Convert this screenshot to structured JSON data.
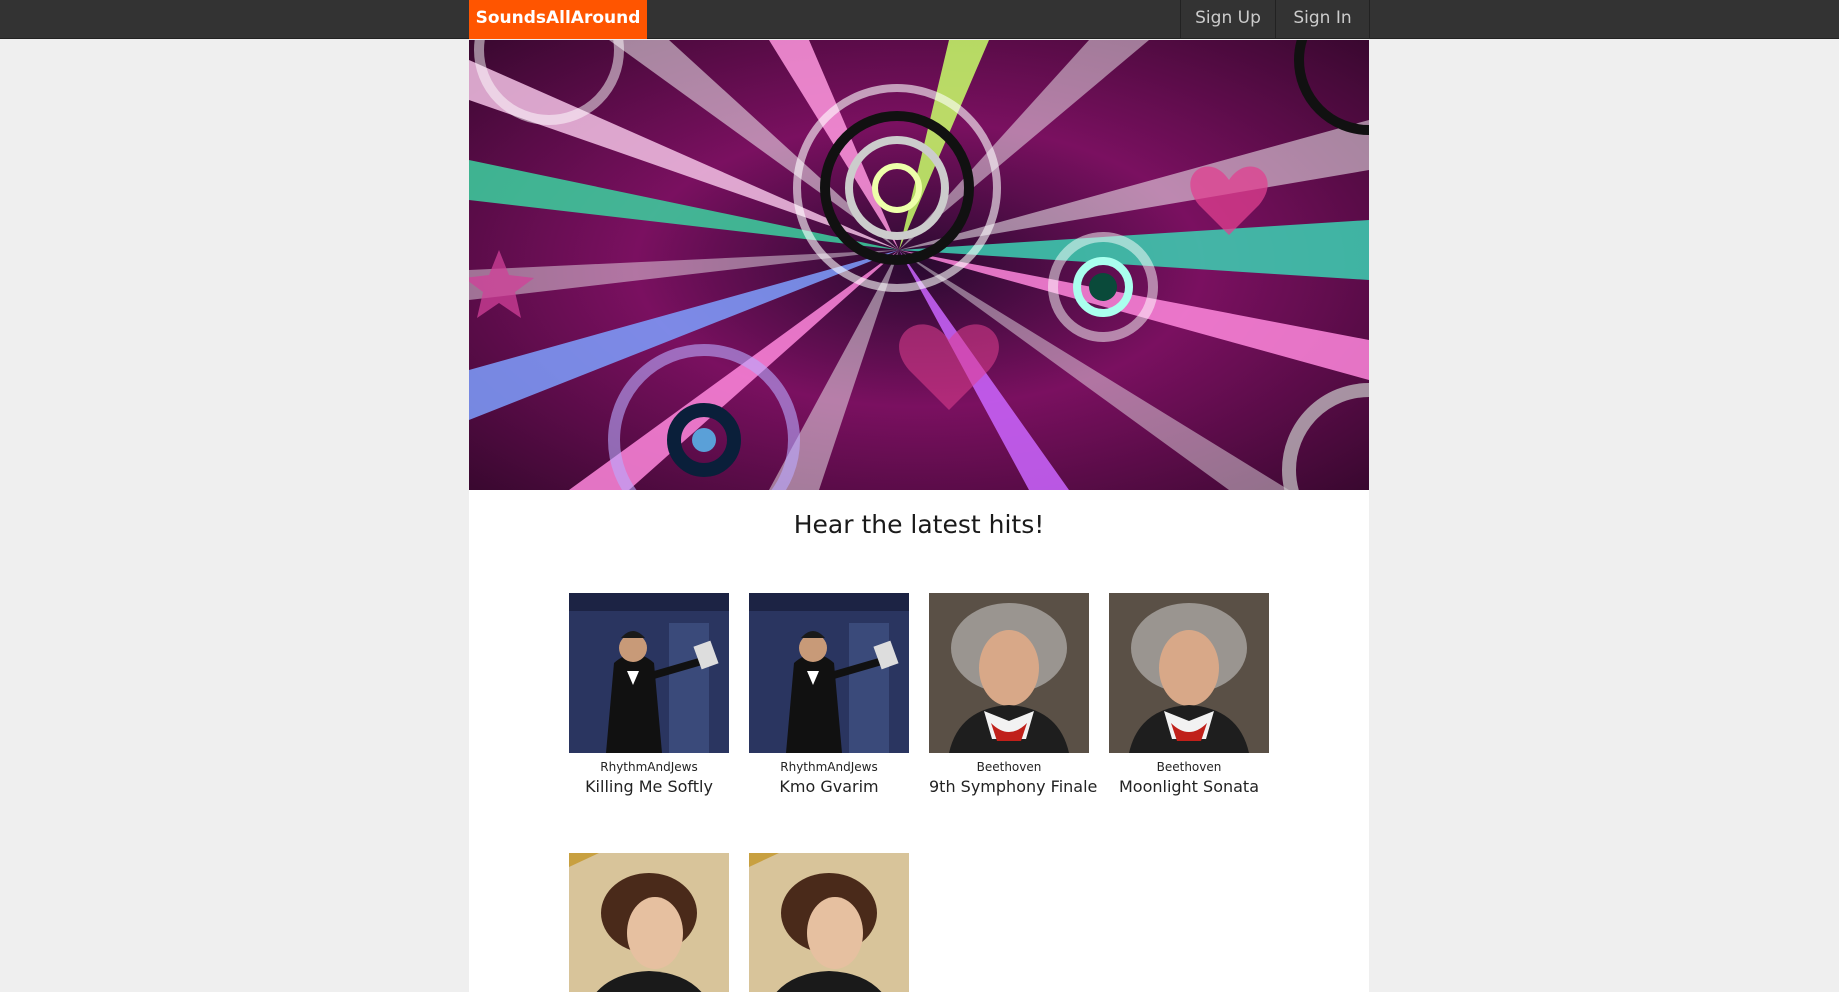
{
  "navbar": {
    "brand": "SoundsAllAround",
    "links": [
      "Sign Up",
      "Sign In"
    ]
  },
  "hero": {
    "image": "abstract-music-burst-banner"
  },
  "headline": "Hear the latest hits!",
  "songs": [
    {
      "artist": "RhythmAndJews",
      "title": "Killing Me Softly",
      "cover": "magician-album-cover"
    },
    {
      "artist": "RhythmAndJews",
      "title": "Kmo Gvarim",
      "cover": "magician-album-cover"
    },
    {
      "artist": "Beethoven",
      "title": "9th Symphony Finale",
      "cover": "beethoven-portrait"
    },
    {
      "artist": "Beethoven",
      "title": "Moonlight Sonata",
      "cover": "beethoven-portrait"
    },
    {
      "artist": "",
      "title": "",
      "cover": "chopin-portrait"
    },
    {
      "artist": "",
      "title": "",
      "cover": "chopin-portrait"
    }
  ],
  "colors": {
    "accent": "#ff5500",
    "navbar": "#333333",
    "page_bg": "#efefef"
  }
}
